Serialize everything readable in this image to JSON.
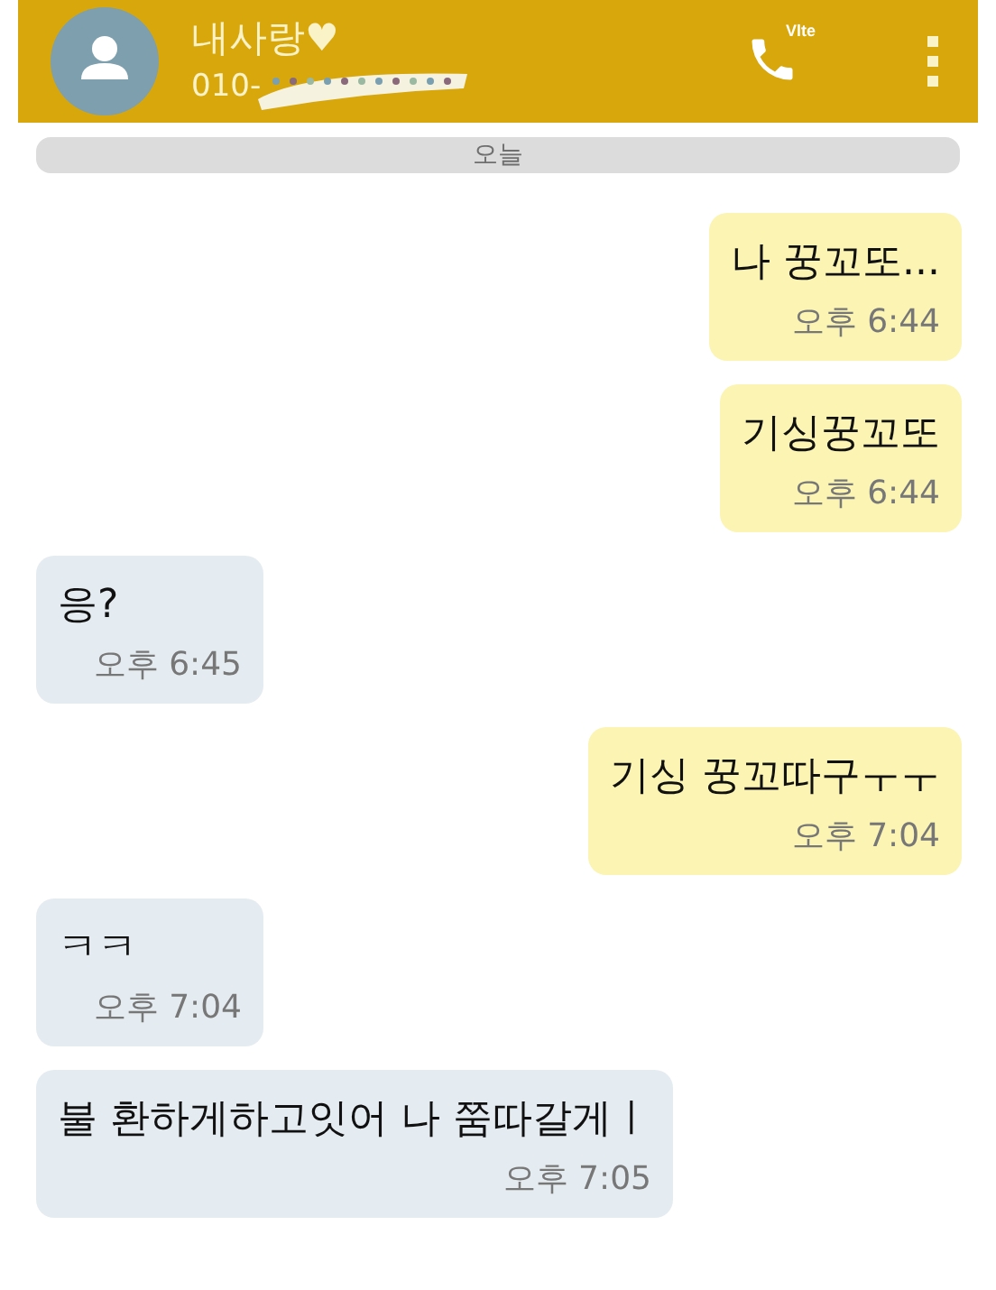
{
  "header": {
    "name": "내사랑♥",
    "number": "010-",
    "call_badge": "Vlte"
  },
  "date_divider": "오늘",
  "messages": [
    {
      "kind": "sent",
      "text": "나 꿍꼬또...",
      "time": "오후 6:44"
    },
    {
      "kind": "sent",
      "text": "기싱꿍꼬또",
      "time": "오후 6:44"
    },
    {
      "kind": "received",
      "text": "응?",
      "time": "오후 6:45"
    },
    {
      "kind": "sent",
      "text": "기싱 꿍꼬따구ㅜㅜ",
      "time": "오후 7:04"
    },
    {
      "kind": "received",
      "text": "ㅋㅋ",
      "time": "오후 7:04"
    },
    {
      "kind": "received",
      "text": "불 환하게하고잇어 나 쭘따갈게ㅣ",
      "time": "오후 7:05"
    }
  ]
}
